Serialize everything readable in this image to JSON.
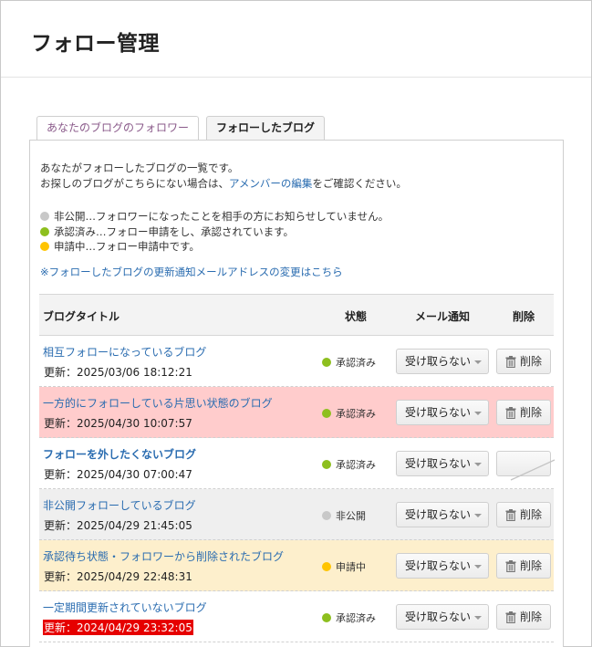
{
  "page": {
    "title": "フォロー管理"
  },
  "tabs": [
    {
      "label": "あなたのブログのフォロワー",
      "active": false
    },
    {
      "label": "フォローしたブログ",
      "active": true
    }
  ],
  "intro": {
    "line1": "あなたがフォローしたブログの一覧です。",
    "line2_prefix": "お探しのブログがこちらにない場合は、",
    "line2_link": "アメンバーの編集",
    "line2_suffix": "をご確認ください。"
  },
  "legend": [
    {
      "color": "#c8c8c8",
      "text": "非公開…フォロワーになったことを相手の方にお知らせしていません。"
    },
    {
      "color": "#8dbf1e",
      "text": "承認済み…フォロー申請をし、承認されています。"
    },
    {
      "color": "#ffc400",
      "text": "申請中…フォロー申請中です。"
    }
  ],
  "email_change_link": "※フォローしたブログの更新通知メールアドレスの変更はこちら",
  "table": {
    "headers": {
      "title": "ブログタイトル",
      "status": "状態",
      "mail": "メール通知",
      "delete": "削除"
    },
    "rows": [
      {
        "title": "相互フォローになっているブログ",
        "updated": "更新：2025/03/06 18:12:21",
        "status": "承認済み",
        "status_color": "#8dbf1e",
        "mail": "受け取らない",
        "delete": "削除",
        "row_bg": ""
      },
      {
        "title": "一方的にフォローしている片思い状態のブログ",
        "updated": "更新：2025/04/30 10:07:57",
        "status": "承認済み",
        "status_color": "#8dbf1e",
        "mail": "受け取らない",
        "delete": "削除",
        "row_bg": "red"
      },
      {
        "title": "フォローを外したくないブログ",
        "updated": "更新：2025/04/30 07:00:47",
        "status": "承認済み",
        "status_color": "#8dbf1e",
        "mail": "受け取らない",
        "delete": "",
        "row_bg": "",
        "bold": true,
        "delete_disabled": true
      },
      {
        "title": "非公開フォローしているブログ",
        "updated": "更新：2025/04/29 21:45:05",
        "status": "非公開",
        "status_color": "#c8c8c8",
        "mail": "受け取らない",
        "delete": "削除",
        "row_bg": "gray"
      },
      {
        "title": "承認待ち状態・フォロワーから削除されたブログ",
        "updated": "更新：2025/04/29 22:48:31",
        "status": "申請中",
        "status_color": "#ffc400",
        "mail": "受け取らない",
        "delete": "削除",
        "row_bg": "yellow"
      },
      {
        "title": "一定期間更新されていないブログ",
        "updated": "更新：2024/04/29 23:32:05",
        "status": "承認済み",
        "status_color": "#8dbf1e",
        "mail": "受け取らない",
        "delete": "削除",
        "row_bg": "",
        "stale": true
      }
    ]
  }
}
